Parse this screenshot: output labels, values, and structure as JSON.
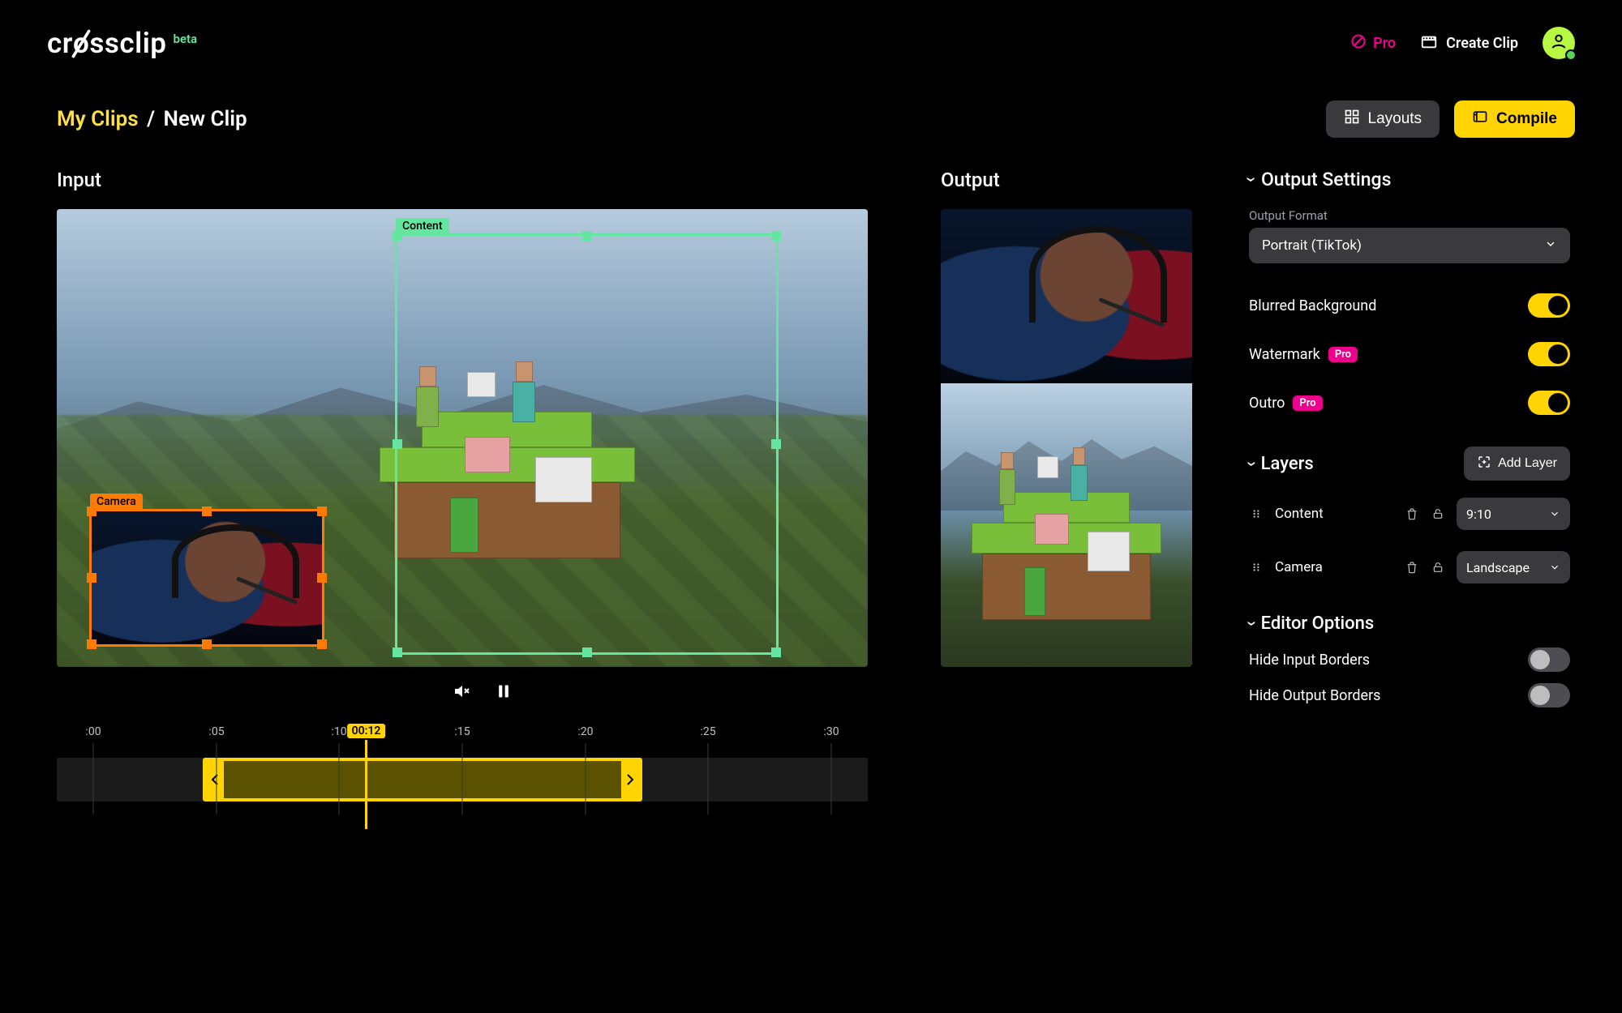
{
  "brand": {
    "name": "crossclip",
    "tag": "beta"
  },
  "header": {
    "pro_label": "Pro",
    "create_label": "Create Clip"
  },
  "breadcrumb": {
    "root": "My Clips",
    "sep": "/",
    "current": "New Clip"
  },
  "actions": {
    "layouts": "Layouts",
    "compile": "Compile"
  },
  "columns": {
    "input": "Input",
    "output": "Output"
  },
  "selection": {
    "content_label": "Content",
    "camera_label": "Camera"
  },
  "timeline": {
    "ticks": [
      ":00",
      ":05",
      ":10",
      ":15",
      ":20",
      ":25",
      ":30"
    ],
    "playhead": "00:12"
  },
  "settings": {
    "title": "Output Settings",
    "format_label": "Output Format",
    "format_value": "Portrait (TikTok)",
    "rows": {
      "blurred": "Blurred Background",
      "watermark": "Watermark",
      "outro": "Outro"
    },
    "pro_pill": "Pro"
  },
  "layers": {
    "title": "Layers",
    "add": "Add Layer",
    "items": [
      {
        "name": "Content",
        "aspect": "9:10"
      },
      {
        "name": "Camera",
        "aspect": "Landscape"
      }
    ]
  },
  "editor": {
    "title": "Editor Options",
    "hide_input": "Hide Input Borders",
    "hide_output": "Hide Output Borders"
  }
}
